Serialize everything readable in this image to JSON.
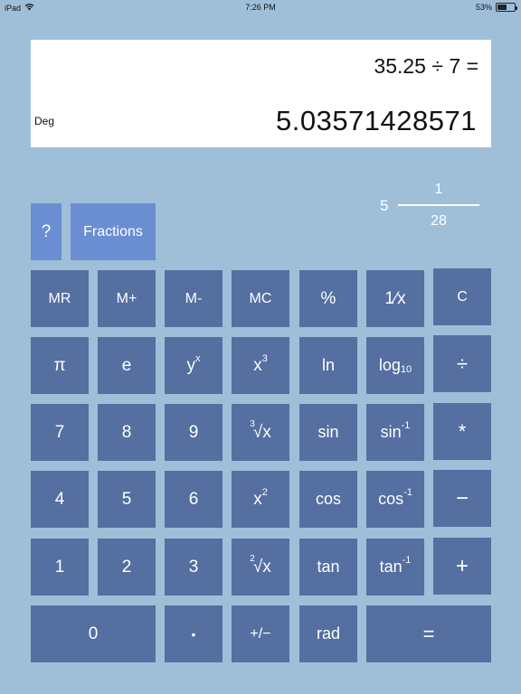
{
  "status_bar": {
    "device": "iPad",
    "time": "7:26 PM",
    "battery": "53%",
    "battery_level": 0.53
  },
  "display": {
    "expression": "35.25 ÷ 7 =",
    "mode": "Deg",
    "result": "5.03571428571"
  },
  "fraction": {
    "whole": "5",
    "numerator": "1",
    "denominator": "28"
  },
  "top_keys": {
    "help": "?",
    "fractions": "Fractions"
  },
  "memory_row": {
    "mr": "MR",
    "m_plus": "M+",
    "m_minus": "M-",
    "mc": "MC",
    "percent": "%",
    "reciprocal": "1⁄x",
    "clear": "C"
  },
  "row2": {
    "pi": "π",
    "e": "e",
    "yx_base": "y",
    "yx_exp": "x",
    "x3_base": "x",
    "x3_exp": "3",
    "ln": "ln",
    "log_base": "log",
    "log_sub": "10",
    "divide": "÷"
  },
  "row3": {
    "seven": "7",
    "eight": "8",
    "nine": "9",
    "cbrt_index": "3",
    "cbrt_body": "√x",
    "sin": "sin",
    "asin_base": "sin",
    "asin_exp": "-1",
    "multiply": "*"
  },
  "row4": {
    "four": "4",
    "five": "5",
    "six": "6",
    "x2_base": "x",
    "x2_exp": "2",
    "cos": "cos",
    "acos_base": "cos",
    "acos_exp": "-1",
    "minus": "−"
  },
  "row5": {
    "one": "1",
    "two": "2",
    "three": "3",
    "sqrt_index": "2",
    "sqrt_body": "√x",
    "tan": "tan",
    "atan_base": "tan",
    "atan_exp": "-1",
    "plus": "+"
  },
  "row6": {
    "zero": "0",
    "dot": "•",
    "negate": "+/−",
    "rad": "rad",
    "equals": "="
  },
  "icons": {
    "wifi": "wifi-icon",
    "battery": "battery-icon"
  }
}
